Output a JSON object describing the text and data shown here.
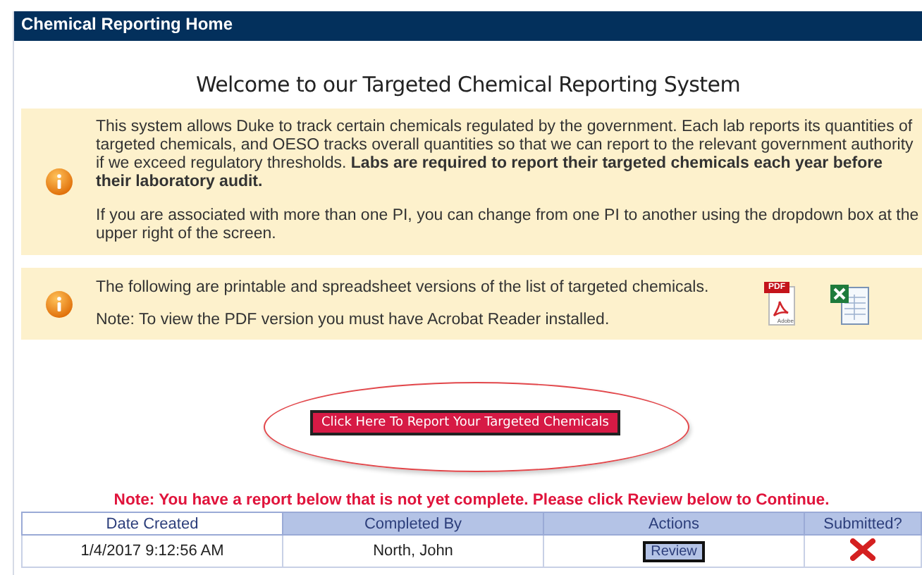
{
  "header": {
    "title": "Chemical Reporting Home"
  },
  "welcome": "Welcome to our Targeted Chemical Reporting System",
  "notices": [
    {
      "kind": "info",
      "paragraphs": [
        "This system allows Duke to track certain chemicals regulated by the government. Each lab reports its quantities of targeted chemicals, and OESO tracks overall quantities so that we can report to the relevant government authority if we exceed regulatory thresholds. **Labs are required to report their targeted chemicals each year before their laboratory audit.**",
        "If you are associated with more than one PI, you can change from one PI to another using the dropdown box at the upper right of the screen."
      ]
    },
    {
      "kind": "downloads",
      "paragraphs": [
        "The following are printable and spreadsheet versions of the list of targeted chemicals.",
        "Note: To view the PDF version you must have Acrobat Reader installed."
      ],
      "files": [
        {
          "kind": "pdf",
          "badge": "PDF",
          "mark": "Adobe"
        },
        {
          "kind": "spreadsheet"
        }
      ]
    }
  ],
  "report_button": {
    "label": "Click Here To Report Your Targeted Chemicals",
    "highlighted": true
  },
  "note": "Note: You have a report below that is not yet complete. Please click Review below to Continue.",
  "table": {
    "columns": [
      "Date Created",
      "Completed By",
      "Actions",
      "Submitted?"
    ],
    "rows": [
      {
        "date_created": "1/4/2017 9:12:56 AM",
        "completed_by": "North, John",
        "action": "Review",
        "submitted": false
      }
    ]
  }
}
